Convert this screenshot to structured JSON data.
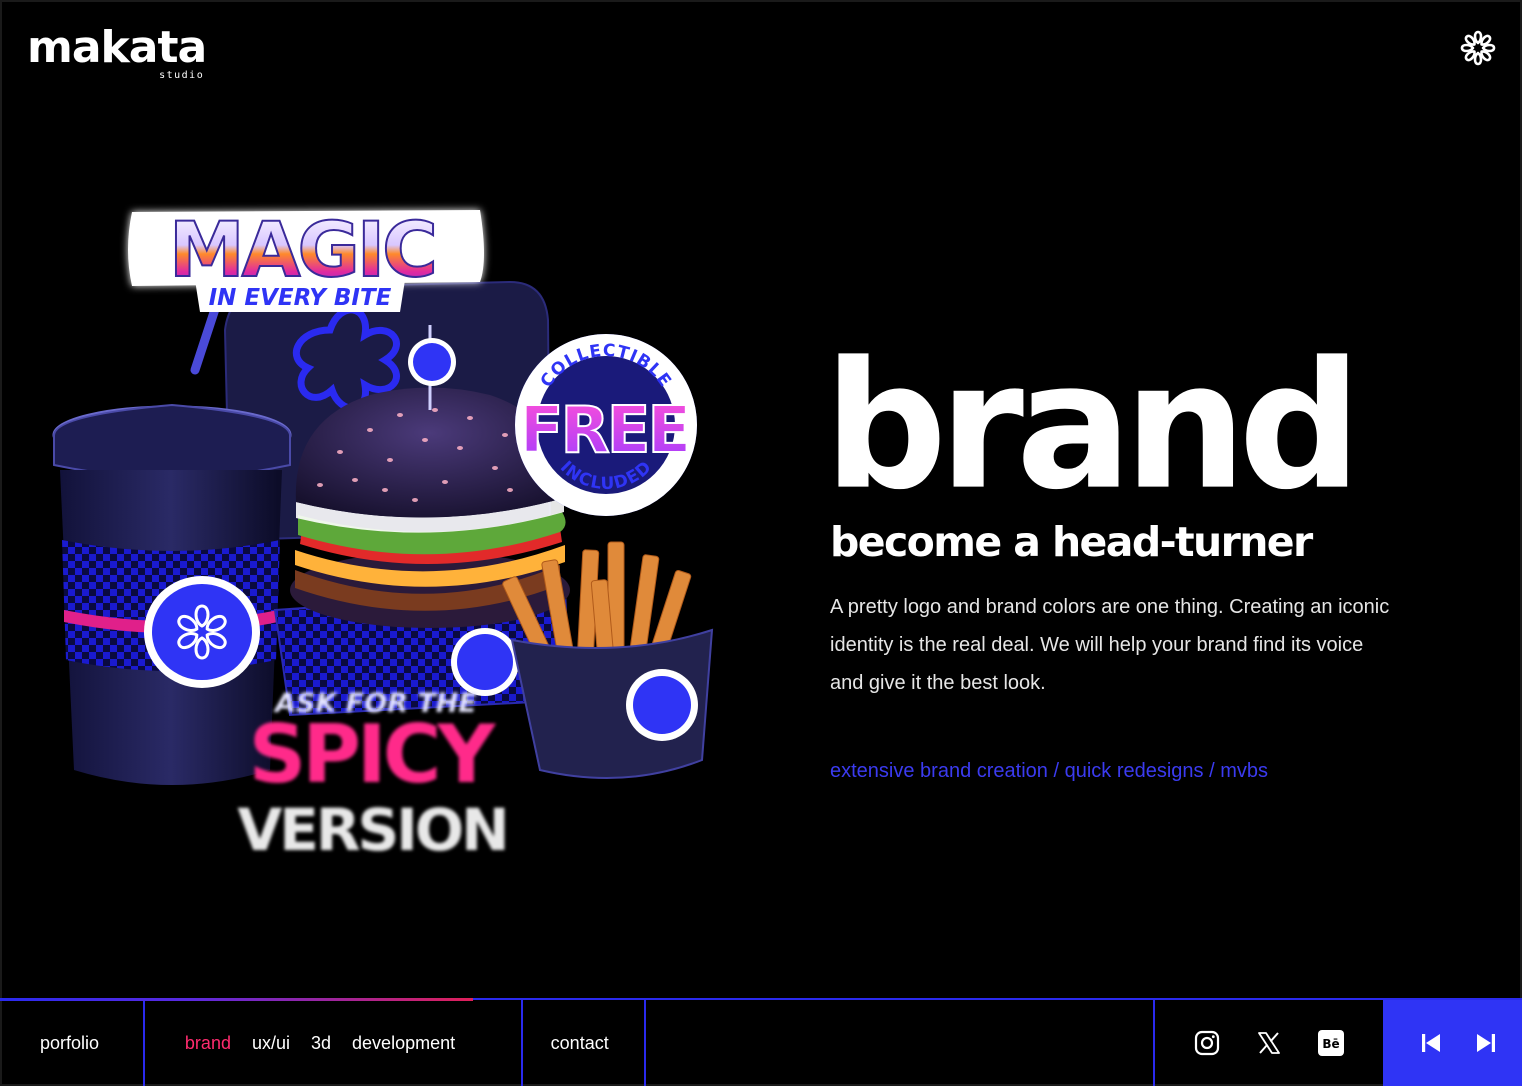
{
  "header": {
    "logo_word": "makata",
    "logo_sub": "studio",
    "menu_icon": "asterisk-flower-icon"
  },
  "hero_art": {
    "sign_top": "MAGIC",
    "sign_sub": "IN EVERY BITE",
    "badge_top": "COLLECTIBLE",
    "badge_main": "FREE",
    "badge_bottom": "INCLUDED",
    "promo_line1": "ASK FOR THE",
    "promo_line2": "SPICY",
    "promo_line3": "VERSION"
  },
  "hero": {
    "title": "brand",
    "subtitle": "become a head-turner",
    "description": "A pretty logo and brand colors are one thing. Creating an iconic identity is the real deal. We will help your brand find its voice and give it the best look.",
    "services": "extensive brand creation / quick redesigns / mvbs"
  },
  "nav": {
    "portfolio": "porfolio",
    "categories": [
      {
        "label": "brand",
        "active": true
      },
      {
        "label": "ux/ui",
        "active": false
      },
      {
        "label": "3d",
        "active": false
      },
      {
        "label": "development",
        "active": false
      }
    ],
    "contact": "contact",
    "social": [
      "instagram-icon",
      "x-icon",
      "behance-icon"
    ],
    "behance_label": "Bē",
    "arrows": [
      "previous-icon",
      "next-icon"
    ]
  },
  "colors": {
    "accent_blue": "#2f34f5",
    "accent_pink": "#ff2b6e",
    "background": "#000000"
  }
}
